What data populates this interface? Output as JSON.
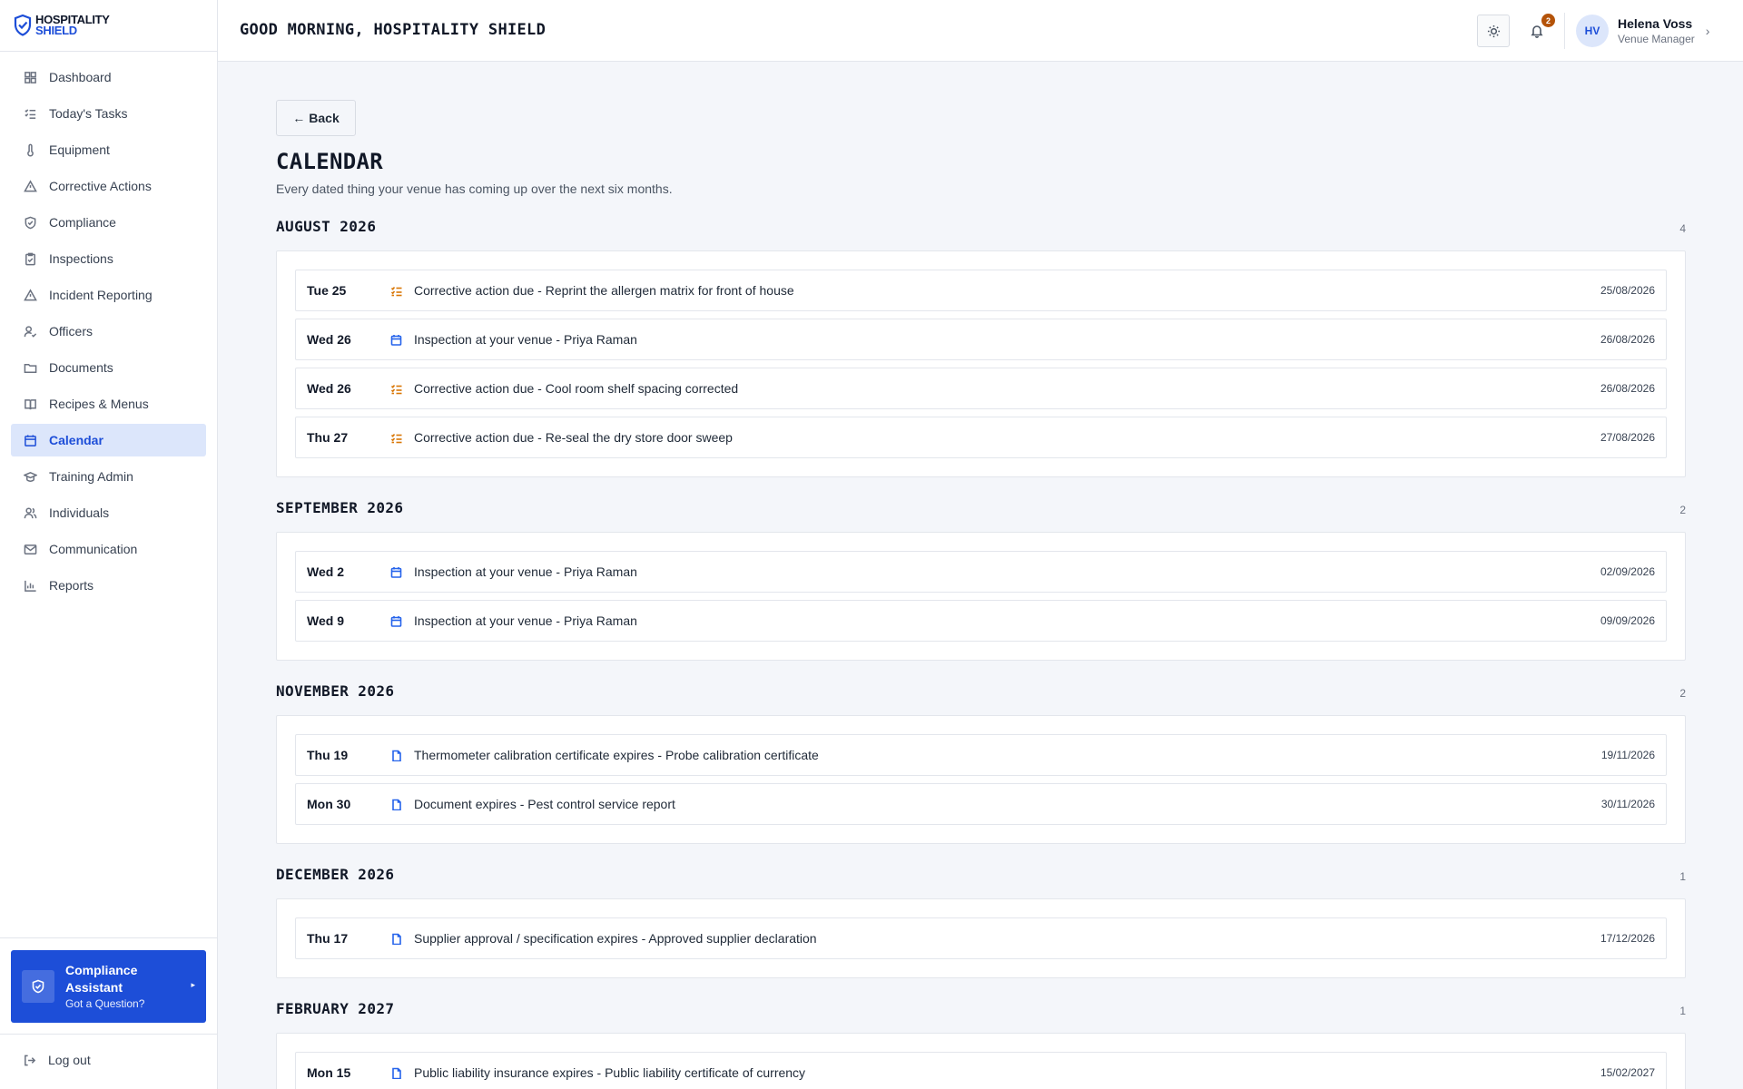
{
  "brand": {
    "line1": "HOSPITALITY",
    "line2": "SHIELD"
  },
  "header": {
    "greeting": "GOOD MORNING, HOSPITALITY SHIELD",
    "notification_count": "2",
    "user": {
      "initials": "HV",
      "name": "Helena Voss",
      "role": "Venue Manager"
    }
  },
  "sidebar": {
    "items": [
      {
        "label": "Dashboard",
        "icon": "grid-icon"
      },
      {
        "label": "Today's Tasks",
        "icon": "checklist-icon"
      },
      {
        "label": "Equipment",
        "icon": "thermometer-icon"
      },
      {
        "label": "Corrective Actions",
        "icon": "warning-icon"
      },
      {
        "label": "Compliance",
        "icon": "shield-check-icon"
      },
      {
        "label": "Inspections",
        "icon": "clipboard-icon"
      },
      {
        "label": "Incident Reporting",
        "icon": "warning-icon"
      },
      {
        "label": "Officers",
        "icon": "user-check-icon"
      },
      {
        "label": "Documents",
        "icon": "folder-icon"
      },
      {
        "label": "Recipes & Menus",
        "icon": "book-icon"
      },
      {
        "label": "Calendar",
        "icon": "calendar-icon",
        "active": true
      },
      {
        "label": "Training Admin",
        "icon": "graduation-cap-icon"
      },
      {
        "label": "Individuals",
        "icon": "users-icon"
      },
      {
        "label": "Communication",
        "icon": "mail-icon"
      },
      {
        "label": "Reports",
        "icon": "bar-chart-icon"
      }
    ],
    "assistant": {
      "title": "Compliance Assistant",
      "subtitle": "Got a Question?"
    },
    "logout": "Log out"
  },
  "main": {
    "back_label": "Back",
    "title": "CALENDAR",
    "subtitle": "Every dated thing your venue has coming up over the next six months.",
    "months": [
      {
        "title": "AUGUST 2026",
        "count": "4",
        "events": [
          {
            "day": "Tue 25",
            "type": "task",
            "text": "Corrective action due - Reprint the allergen matrix for front of house",
            "date": "25/08/2026"
          },
          {
            "day": "Wed 26",
            "type": "calendar",
            "text": "Inspection at your venue - Priya Raman",
            "date": "26/08/2026"
          },
          {
            "day": "Wed 26",
            "type": "task",
            "text": "Corrective action due - Cool room shelf spacing corrected",
            "date": "26/08/2026"
          },
          {
            "day": "Thu 27",
            "type": "task",
            "text": "Corrective action due - Re-seal the dry store door sweep",
            "date": "27/08/2026"
          }
        ]
      },
      {
        "title": "SEPTEMBER 2026",
        "count": "2",
        "events": [
          {
            "day": "Wed 2",
            "type": "calendar",
            "text": "Inspection at your venue - Priya Raman",
            "date": "02/09/2026"
          },
          {
            "day": "Wed 9",
            "type": "calendar",
            "text": "Inspection at your venue - Priya Raman",
            "date": "09/09/2026"
          }
        ]
      },
      {
        "title": "NOVEMBER 2026",
        "count": "2",
        "events": [
          {
            "day": "Thu 19",
            "type": "document",
            "text": "Thermometer calibration certificate expires - Probe calibration certificate",
            "date": "19/11/2026"
          },
          {
            "day": "Mon 30",
            "type": "document",
            "text": "Document expires - Pest control service report",
            "date": "30/11/2026"
          }
        ]
      },
      {
        "title": "DECEMBER 2026",
        "count": "1",
        "events": [
          {
            "day": "Thu 17",
            "type": "document",
            "text": "Supplier approval / specification expires - Approved supplier declaration",
            "date": "17/12/2026"
          }
        ]
      },
      {
        "title": "FEBRUARY 2027",
        "count": "1",
        "events": [
          {
            "day": "Mon 15",
            "type": "document",
            "text": "Public liability insurance expires - Public liability certificate of currency",
            "date": "15/02/2027"
          }
        ]
      }
    ]
  },
  "colors": {
    "accent": "#1d4ed8",
    "task_icon": "#d97706",
    "calendar_icon": "#2563eb",
    "document_icon": "#2563eb",
    "badge": "#b45309"
  }
}
